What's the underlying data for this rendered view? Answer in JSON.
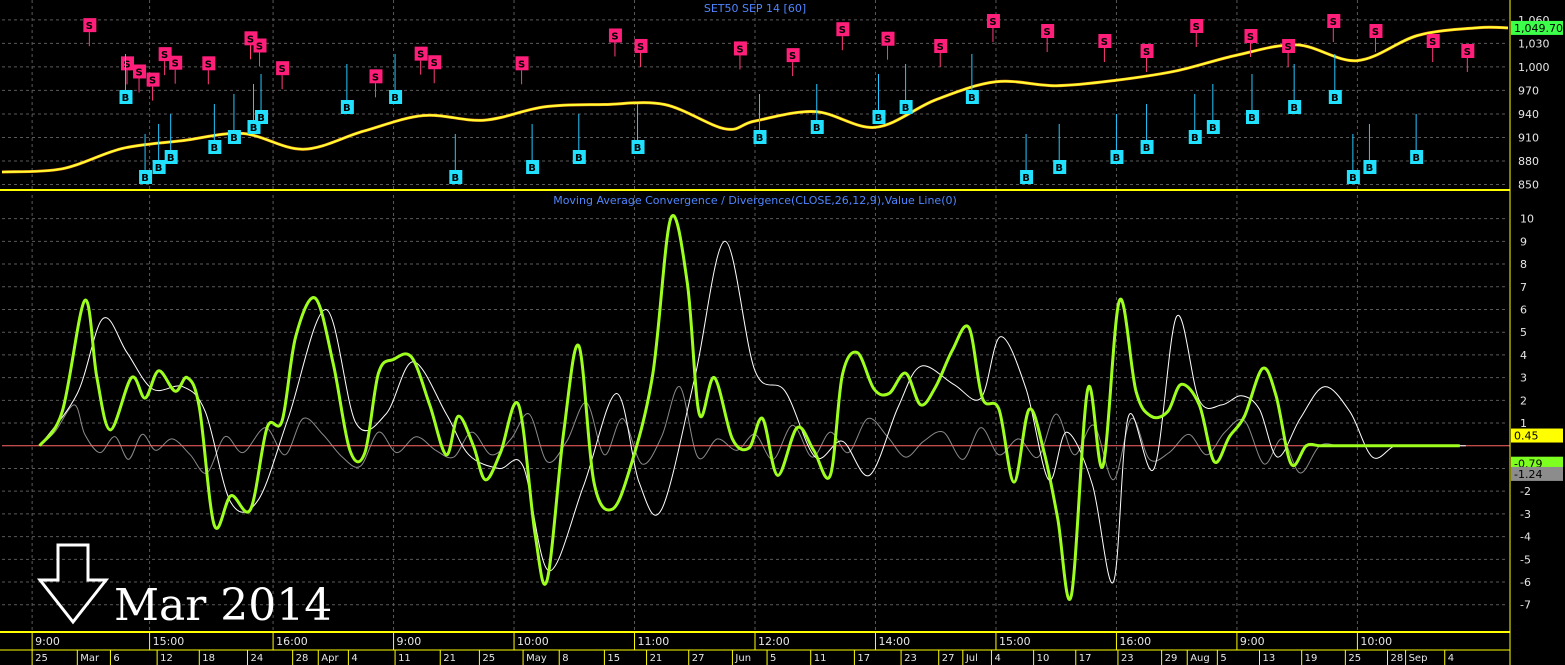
{
  "chart_data": [
    {
      "type": "line",
      "title": "SET50 SEP 14 [60]",
      "y_ticks": [
        "1,060",
        "1,030",
        "1,000",
        "970",
        "940",
        "910",
        "880",
        "850"
      ],
      "ylim": [
        843,
        1070
      ],
      "last_value_label": "1,049.70",
      "colors": {
        "price": "#ffff33",
        "buy": "#22e1ff",
        "sell": "#ff1f7a",
        "grid": "#5a5a5a",
        "axis": "#ffff00"
      },
      "series": [
        {
          "x": [
            0,
            4,
            8,
            12,
            16,
            20,
            24,
            28,
            32,
            36,
            40,
            44,
            48,
            52,
            56,
            60,
            64,
            68,
            72,
            76,
            80,
            84,
            88,
            92,
            96,
            100
          ],
          "y": [
            866,
            870,
            896,
            906,
            915,
            895,
            918,
            938,
            932,
            949,
            952,
            952,
            921,
            937,
            944,
            924,
            980,
            983,
            972,
            978,
            990,
            1004,
            1022,
            1025,
            1027,
            1018
          ]
        },
        {
          "x": [
            50,
            54,
            58,
            62,
            66,
            70,
            74,
            78,
            82,
            86,
            90,
            94,
            98,
            100
          ],
          "y": [
            931,
            943,
            923,
            958,
            981,
            976,
            983,
            995,
            1015,
            1028,
            1008,
            1040,
            1050,
            1049.7
          ]
        }
      ],
      "signals_sell_label": "S",
      "signals_buy_label": "B",
      "sell_x": [
        5.8,
        8.3,
        9.1,
        10,
        10.8,
        11.5,
        13.7,
        16.5,
        17.1,
        18.6,
        24.8,
        27.8,
        28.7,
        34.5,
        40.7,
        42.4,
        49,
        52.5,
        55.8,
        58.8,
        62.3,
        65.8,
        69.4,
        73.2,
        76,
        79.3,
        82.9,
        85.4,
        88.4,
        91.2,
        95,
        97.3
      ],
      "sell_y": [
        1000,
        940,
        944,
        948,
        949,
        952,
        972,
        972,
        978,
        951,
        955,
        950,
        953,
        972,
        978,
        977,
        993,
        1000,
        1002,
        1003,
        1010,
        1018,
        1023,
        1024,
        1026,
        1035,
        1042,
        1040,
        1045,
        1046,
        1057,
        1062
      ],
      "buy_x": [
        8.2,
        9.5,
        10.4,
        11.2,
        14.1,
        15.4,
        16.7,
        17.2,
        22.9,
        26.1,
        30.1,
        35.2,
        38.3,
        42.2,
        50.3,
        54.1,
        58.2,
        60,
        64.4,
        68,
        70.2,
        74,
        76,
        79.2,
        80.4,
        83,
        85.8,
        88.5,
        89.7,
        90.8,
        93.9
      ],
      "buy_y": [
        1010,
        1012,
        1015,
        1016,
        1014,
        1010,
        1012,
        1016,
        1005,
        1006,
        1004,
        1005,
        1015,
        1015,
        1010,
        1010,
        1010,
        1005,
        1016,
        1016,
        1014,
        1018,
        1020,
        1030,
        1030,
        1026,
        1026,
        1025,
        1030,
        1032,
        1038
      ]
    },
    {
      "type": "line",
      "title": "Moving Average Convergence / Divergence(CLOSE,26,12,9),Value Line(0)",
      "y_ticks": [
        "10",
        "9",
        "8",
        "7",
        "6",
        "5",
        "4",
        "3",
        "2",
        "1",
        "-1",
        "-2",
        "-3",
        "-4",
        "-5",
        "-6",
        "-7"
      ],
      "ylim": [
        -8.2,
        10.6
      ],
      "value_line": 0,
      "right_labels": [
        "0.45",
        "-0.79",
        "-1.24"
      ],
      "colors": {
        "macd": "#9eff1f",
        "signal": "#ffffff",
        "hist": "#8a8a8a",
        "zero": "#ff6666",
        "grid": "#5a5a5a",
        "axis": "#ffff00"
      },
      "series": [
        {
          "name": "MACD",
          "x": [
            2.5,
            4,
            5.5,
            6.3,
            7.2,
            8.6,
            9.5,
            10.4,
            11.5,
            12.3,
            13.1,
            14.1,
            15.2,
            16.5,
            17.6,
            18.6,
            19.5,
            20.8,
            22,
            23.1,
            24.1,
            25,
            26,
            27.2,
            28.4,
            29.5,
            30.3,
            31.3,
            32.1,
            33.1,
            34.3,
            35.4,
            36.2,
            37.3,
            38.3,
            39.3,
            40.5,
            41.7,
            43.2,
            44.4,
            45.5,
            46.3,
            47.3,
            48.5,
            49.6,
            50.5,
            51.5,
            52.8,
            53.9,
            55,
            55.8,
            56.8,
            57.9,
            58.9,
            60,
            61,
            62,
            63.1,
            64.2,
            65.1,
            66.2,
            67.2,
            68.2,
            69.2,
            70.1,
            71,
            72.1,
            73.1,
            74.2,
            75.3,
            76.3,
            77.4,
            78.3,
            79.5,
            80.5,
            81.5,
            82.5,
            83.7,
            84.6,
            85.6,
            86.6,
            87.5,
            88.5,
            89.6,
            90.5,
            91.5,
            92.5,
            93.6,
            94.6,
            95.4,
            96.3,
            96.8
          ],
          "y": [
            0,
            1.5,
            6.4,
            3,
            0.7,
            3,
            2.1,
            3.3,
            2.4,
            3,
            1.7,
            -3.5,
            -2.2,
            -2.8,
            0.8,
            1.1,
            4.8,
            6.5,
            3.6,
            -0.2,
            -0.3,
            3.2,
            3.8,
            3.9,
            1.8,
            -0.4,
            1.3,
            0,
            -1.5,
            -0.3,
            1.8,
            -3.9,
            -5.9,
            0.6,
            4.4,
            -1.6,
            -2.8,
            -1,
            3.1,
            10,
            7.2,
            1.4,
            3,
            0.3,
            -0.1,
            1.2,
            -1.3,
            0.8,
            -0.2,
            -1.3,
            3.1,
            4.1,
            2.5,
            2.3,
            3.2,
            1.8,
            2.6,
            4.2,
            5.2,
            2.1,
            1.6,
            -1.6,
            1.6,
            -0.3,
            -3.2,
            -6.6,
            2.5,
            -0.9,
            6.4,
            2.4,
            1.3,
            1.5,
            2.7,
            1.8,
            -0.7,
            0.4,
            1.3,
            3.4,
            2.2,
            -0.8,
            0,
            0,
            0,
            0,
            0,
            0,
            0,
            0,
            0,
            0,
            0,
            0
          ],
          "width": 3
        },
        {
          "name": "Signal",
          "x": [
            2.5,
            5,
            6.7,
            8.3,
            10,
            12,
            13.5,
            15.2,
            17,
            19,
            21.5,
            23.5,
            25.5,
            27.3,
            29.5,
            31,
            33,
            34.6,
            36.3,
            38.6,
            40.8,
            42.3,
            43.8,
            46,
            48,
            50,
            52,
            54,
            55.8,
            57.6,
            59.5,
            61,
            63.2,
            65,
            66.3,
            68,
            69.5,
            70.7,
            72.4,
            73.8,
            74.8,
            76.5,
            78,
            79.5,
            81,
            82.3,
            83.5,
            84.7,
            86.2,
            87.8,
            89.5,
            91,
            92.5,
            94,
            95,
            96.2,
            97.2
          ],
          "y": [
            0,
            2.3,
            5.6,
            4.1,
            2.5,
            2.6,
            1.5,
            -2.5,
            -2.4,
            1.2,
            6,
            1,
            1.4,
            3.7,
            1.4,
            -0.4,
            -1,
            -0.9,
            -5.5,
            -1.8,
            2.3,
            -1.6,
            -2.8,
            3,
            9,
            3.3,
            2.4,
            -0.5,
            0.2,
            -1.3,
            1.7,
            3.5,
            2.7,
            2.1,
            4.8,
            2.5,
            -1.5,
            0.6,
            -1.7,
            -6,
            1.3,
            -1,
            5.7,
            2,
            1.8,
            2.2,
            1.6,
            -0.5,
            1.2,
            2.6,
            1.5,
            -0.5,
            0,
            0,
            0,
            0,
            0
          ],
          "width": 1
        },
        {
          "name": "Histogram",
          "x": [
            2.5,
            3.5,
            4.8,
            5.5,
            6.5,
            7.5,
            8.4,
            9.3,
            10.2,
            11.3,
            12.5,
            13.6,
            14.8,
            16,
            17.5,
            18.8,
            20,
            21.3,
            22.6,
            23.8,
            25,
            26.2,
            27.5,
            28.8,
            30,
            31.2,
            32.5,
            33.8,
            35,
            36.2,
            37.5,
            38.8,
            40,
            41.2,
            42.5,
            43.8,
            45,
            46.2,
            47.5,
            48.8,
            50,
            51.2,
            52.5,
            53.8,
            55,
            56.2,
            57.5,
            58.8,
            60,
            61.2,
            62.5,
            63.8,
            65,
            66.2,
            67.5,
            68.8,
            70,
            71.2,
            72.5,
            73.8,
            75,
            76.2,
            77.5,
            78.8,
            80,
            81.2,
            82.5,
            83.8,
            85,
            86.2,
            87.5,
            88.8,
            90,
            91.2,
            92.5,
            93.8,
            95,
            96.2
          ],
          "y": [
            0,
            0.6,
            1.8,
            0.5,
            -0.3,
            0.4,
            -0.6,
            0.5,
            -0.2,
            0.3,
            -0.4,
            -1.2,
            0.4,
            -0.3,
            0.8,
            -0.4,
            1.2,
            0.5,
            -0.5,
            -0.9,
            0.6,
            -0.3,
            0.4,
            -0.2,
            -0.5,
            0.6,
            -0.4,
            0.3,
            1.4,
            -0.7,
            0.2,
            1.9,
            -0.4,
            1.2,
            -0.8,
            0.4,
            2.6,
            -0.5,
            0.3,
            -0.2,
            0.5,
            -0.6,
            0.9,
            -0.5,
            0.6,
            -0.3,
            1.2,
            0.4,
            -0.5,
            0.2,
            0.6,
            -0.6,
            0.8,
            -0.4,
            0.3,
            -0.5,
            1.4,
            -0.4,
            0.9,
            -1.5,
            1.2,
            -0.6,
            -0.3,
            0.5,
            -0.4,
            0.6,
            1.1,
            -0.8,
            0.3,
            -1.2,
            0,
            0,
            0,
            0,
            0,
            0,
            0,
            0
          ],
          "width": 1
        }
      ]
    }
  ],
  "time_axis": {
    "top_labels": [
      {
        "x": 2,
        "t": "9:00"
      },
      {
        "x": 9.8,
        "t": "15:00"
      },
      {
        "x": 18,
        "t": "16:00"
      },
      {
        "x": 26,
        "t": "9:00"
      },
      {
        "x": 34,
        "t": "10:00"
      },
      {
        "x": 42,
        "t": "11:00"
      },
      {
        "x": 50,
        "t": "12:00"
      },
      {
        "x": 58,
        "t": "14:00"
      },
      {
        "x": 66,
        "t": "15:00"
      },
      {
        "x": 74,
        "t": "16:00"
      },
      {
        "x": 82,
        "t": "9:00"
      },
      {
        "x": 90,
        "t": "10:00"
      }
    ],
    "bottom_labels": [
      {
        "x": 2,
        "t": "25"
      },
      {
        "x": 5,
        "t": "Mar"
      },
      {
        "x": 7.2,
        "t": "6"
      },
      {
        "x": 10.3,
        "t": "12"
      },
      {
        "x": 13.1,
        "t": "18"
      },
      {
        "x": 16.3,
        "t": "24"
      },
      {
        "x": 19.3,
        "t": "28"
      },
      {
        "x": 21,
        "t": "Apr"
      },
      {
        "x": 23,
        "t": "4"
      },
      {
        "x": 26.1,
        "t": "11"
      },
      {
        "x": 29.1,
        "t": "21"
      },
      {
        "x": 31.7,
        "t": "25"
      },
      {
        "x": 34.6,
        "t": "May"
      },
      {
        "x": 37,
        "t": "8"
      },
      {
        "x": 40,
        "t": "15"
      },
      {
        "x": 42.8,
        "t": "21"
      },
      {
        "x": 45.6,
        "t": "27"
      },
      {
        "x": 48.5,
        "t": "Jun"
      },
      {
        "x": 50.8,
        "t": "5"
      },
      {
        "x": 53.7,
        "t": "11"
      },
      {
        "x": 56.6,
        "t": "17"
      },
      {
        "x": 59.7,
        "t": "23"
      },
      {
        "x": 62.2,
        "t": "27"
      },
      {
        "x": 63.8,
        "t": "Jul"
      },
      {
        "x": 65.7,
        "t": "4"
      },
      {
        "x": 68.5,
        "t": "10"
      },
      {
        "x": 71.3,
        "t": "17"
      },
      {
        "x": 74.1,
        "t": "23"
      },
      {
        "x": 77,
        "t": "29"
      },
      {
        "x": 78.7,
        "t": "Aug"
      },
      {
        "x": 80.7,
        "t": "5"
      },
      {
        "x": 83.5,
        "t": "13"
      },
      {
        "x": 86.3,
        "t": "19"
      },
      {
        "x": 89.2,
        "t": "25"
      },
      {
        "x": 92,
        "t": "28"
      },
      {
        "x": 93.2,
        "t": "Sep"
      },
      {
        "x": 95.8,
        "t": "4"
      }
    ]
  },
  "annotation": {
    "text": "Mar 2014",
    "arrow": "down-arrow-icon"
  }
}
